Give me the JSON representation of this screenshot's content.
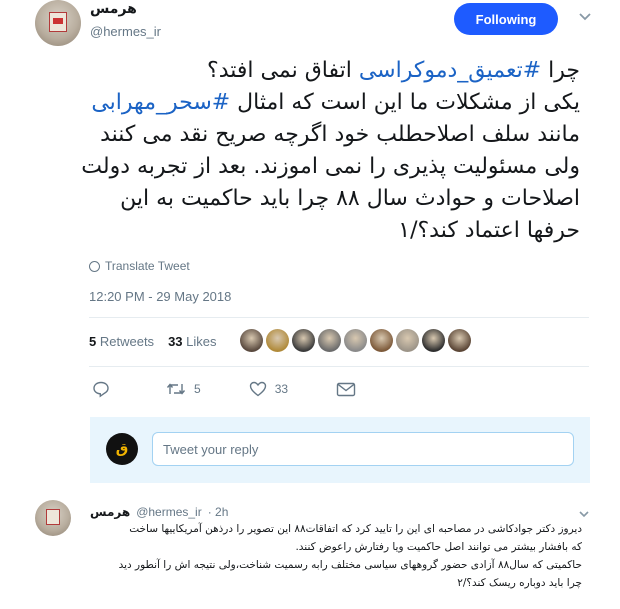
{
  "tweet": {
    "display_name": "هرمس",
    "handle": "@hermes_ir",
    "follow_label": "Following",
    "lines": [
      [
        {
          "t": "چرا "
        },
        {
          "t": "#تعمیق_دموکراسی",
          "tag": true
        },
        {
          "t": " اتفاق نمی افتد؟"
        }
      ],
      [
        {
          "t": "یکی از مشکلات ما این است که امثال "
        },
        {
          "t": "#سحر_مهرابی",
          "tag": true
        }
      ],
      [
        {
          "t": "مانند سلف اصلاحطلب خود اگرچه صریح نقد می کنند"
        }
      ],
      [
        {
          "t": "ولی مسئولیت پذیری را نمی اموزند. بعد از تجربه دولت"
        }
      ],
      [
        {
          "t": "اصلاحات و حوادث سال ۸۸ چرا باید حاکمیت به این"
        }
      ],
      [
        {
          "t": "حرفها اعتماد کند؟/۱"
        }
      ]
    ],
    "translate_label": "Translate Tweet",
    "timestamp": "12:20 PM - 29 May 2018",
    "retweets_count": "5",
    "retweets_label": "Retweets",
    "likes_count": "33",
    "likes_label": "Likes",
    "reply_count": "",
    "retweet_action_count": "5",
    "like_action_count": "33",
    "liker_colors": [
      "#5a4a3f",
      "#b08a3a",
      "#3b3b3b",
      "#6b6b6b",
      "#8a8a8a",
      "#7d5a3a",
      "#9c9488",
      "#2e2e2e",
      "#5b4636"
    ]
  },
  "reply_box": {
    "placeholder": "Tweet your reply",
    "avatar_text": "ق"
  },
  "reply_tweet": {
    "display_name": "هرمس",
    "handle": "@hermes_ir",
    "time": "· 2h",
    "lines": [
      "دیروز دکتر جوادکاشی در مصاحبه ای این را تایید کرد که اتفاقات۸۸ این تصویر را درذهن آمریکاییها ساخت",
      "که بافشار بیشتر می توانند اصل حاکمیت ویا رفتارش راعوض کنند.",
      "حاکمیتی که سال۸۸ آزادی حضور گروههای سیاسی مختلف رابه رسمیت شناخت،ولی نتیجه اش را آنطور دید",
      "چرا باید دوباره ریسک کند؟/۲"
    ]
  },
  "colors": {
    "accent": "#1e5bff",
    "hashtag": "#1b63c5",
    "muted": "#657786"
  }
}
